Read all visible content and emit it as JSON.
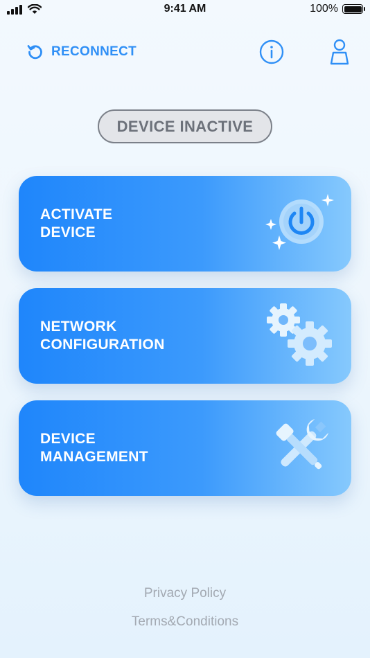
{
  "status_bar": {
    "time": "9:41 AM",
    "battery": "100%"
  },
  "header": {
    "reconnect_label": "RECONNECT"
  },
  "status_pill": {
    "label": "DEVICE INACTIVE"
  },
  "cards": [
    {
      "line1": "ACTIVATE",
      "line2": "DEVICE",
      "icon": "power-icon"
    },
    {
      "line1": "NETWORK",
      "line2": "CONFIGURATION",
      "icon": "gears-icon"
    },
    {
      "line1": "DEVICE",
      "line2": "MANAGEMENT",
      "icon": "tools-icon"
    }
  ],
  "footer": {
    "privacy": "Privacy Policy",
    "terms": "Terms&Conditions"
  },
  "colors": {
    "accent": "#2f8ff6",
    "card_start": "#1f86fb",
    "card_end": "#86c9fd",
    "pill_border": "#7b8089",
    "footer_text": "#a3a9b2"
  }
}
